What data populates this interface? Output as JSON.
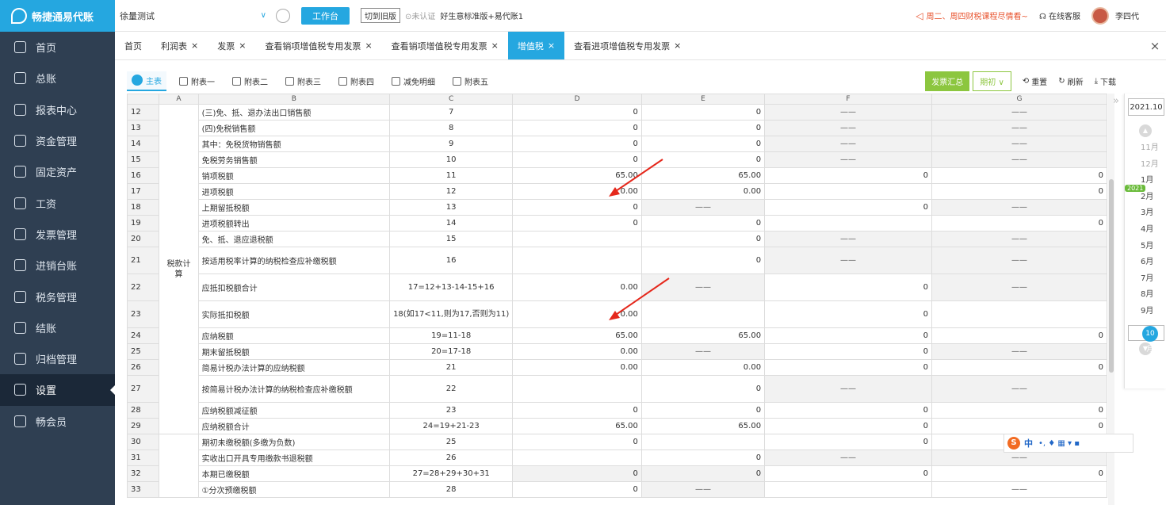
{
  "app": {
    "name": "畅捷通易代账"
  },
  "sidebar": {
    "items": [
      {
        "label": "首页",
        "icon": "home-icon"
      },
      {
        "label": "总账",
        "icon": "ledger-icon"
      },
      {
        "label": "报表中心",
        "icon": "chart-icon"
      },
      {
        "label": "资金管理",
        "icon": "money-icon"
      },
      {
        "label": "固定资产",
        "icon": "asset-icon"
      },
      {
        "label": "工资",
        "icon": "salary-icon"
      },
      {
        "label": "发票管理",
        "icon": "invoice-icon"
      },
      {
        "label": "进销台账",
        "icon": "inventory-icon"
      },
      {
        "label": "税务管理",
        "icon": "tax-icon"
      },
      {
        "label": "结账",
        "icon": "close-book-icon"
      },
      {
        "label": "归档管理",
        "icon": "archive-icon"
      },
      {
        "label": "设置",
        "icon": "gear-icon",
        "active": true
      },
      {
        "label": "畅会员",
        "icon": "member-icon"
      }
    ]
  },
  "topbar": {
    "company": "徐量测试",
    "workbench": "工作台",
    "switch_old": "切到旧版",
    "cert": "未认证",
    "account_info": "好生意标准版+易代账1",
    "notice": "周二、周四财税课程尽情看~",
    "service": "在线客服",
    "user": "李四代"
  },
  "tabs": [
    {
      "label": "首页",
      "closable": false
    },
    {
      "label": "利润表",
      "closable": true
    },
    {
      "label": "发票",
      "closable": true
    },
    {
      "label": "查看销项增值税专用发票",
      "closable": true
    },
    {
      "label": "查看销项增值税专用发票",
      "closable": true
    },
    {
      "label": "增值税",
      "closable": true,
      "active": true
    },
    {
      "label": "查看进项增值税专用发票",
      "closable": true
    }
  ],
  "close_symbol": "×",
  "subtabs": [
    "主表",
    "附表一",
    "附表二",
    "附表三",
    "附表四",
    "减免明细",
    "附表五"
  ],
  "actions": {
    "summary": "发票汇总",
    "period": "期初",
    "reset": "重置",
    "refresh": "刷新",
    "download": "下载"
  },
  "sheet": {
    "cols": [
      "A",
      "B",
      "C",
      "D",
      "E",
      "F",
      "G"
    ],
    "section_label": "税款计算",
    "rows": [
      {
        "n": "12",
        "b": "(三)免、抵、退办法出口销售额",
        "c": "7",
        "d": "0",
        "e": "0",
        "f": "——",
        "g": "——",
        "gf": true
      },
      {
        "n": "13",
        "b": "(四)免税销售额",
        "c": "8",
        "d": "0",
        "e": "0",
        "f": "——",
        "g": "——",
        "gf": true
      },
      {
        "n": "14",
        "b": "其中：免税货物销售额",
        "c": "9",
        "d": "0",
        "e": "0",
        "f": "——",
        "g": "——",
        "gf": true
      },
      {
        "n": "15",
        "b": "免税劳务销售额",
        "c": "10",
        "d": "0",
        "e": "0",
        "f": "——",
        "g": "——",
        "gf": true
      },
      {
        "n": "16",
        "b": "销项税额",
        "c": "11",
        "d": "65.00",
        "e": "65.00",
        "f": "0",
        "g": "0"
      },
      {
        "n": "17",
        "b": "进项税额",
        "c": "12",
        "d": "0.00",
        "e": "0.00",
        "f": "",
        "g": "0"
      },
      {
        "n": "18",
        "b": "上期留抵税额",
        "c": "13",
        "d": "0",
        "e": "——",
        "f": "0",
        "g": "——",
        "ge": true
      },
      {
        "n": "19",
        "b": "进项税额转出",
        "c": "14",
        "d": "0",
        "e": "0",
        "f": "",
        "g": "0"
      },
      {
        "n": "20",
        "b": "免、抵、退应退税额",
        "c": "15",
        "d": "",
        "e": "0",
        "f": "——",
        "g": "——",
        "gf": true
      },
      {
        "n": "21",
        "b": "按适用税率计算的纳税检查应补缴税额",
        "c": "16",
        "d": "",
        "e": "0",
        "f": "——",
        "g": "——",
        "tall": true,
        "gf": true
      },
      {
        "n": "22",
        "b": "应抵扣税额合计",
        "c": "17=12+13-14-15+16",
        "d": "0.00",
        "e": "——",
        "f": "0",
        "g": "——",
        "tall": true,
        "ge": true
      },
      {
        "n": "23",
        "b": "实际抵扣税额",
        "c": "18(如17<11,则为17,否则为11)",
        "d": "0.00",
        "e": "",
        "f": "0",
        "g": "",
        "tall": true
      },
      {
        "n": "24",
        "b": "应纳税额",
        "c": "19=11-18",
        "d": "65.00",
        "e": "65.00",
        "f": "0",
        "g": "0"
      },
      {
        "n": "25",
        "b": "期末留抵税额",
        "c": "20=17-18",
        "d": "0.00",
        "e": "——",
        "f": "0",
        "g": "——",
        "ge": true
      },
      {
        "n": "26",
        "b": "简易计税办法计算的应纳税额",
        "c": "21",
        "d": "0.00",
        "e": "0.00",
        "f": "0",
        "g": "0"
      },
      {
        "n": "27",
        "b": "按简易计税办法计算的纳税检查应补缴税额",
        "c": "22",
        "d": "",
        "e": "0",
        "f": "——",
        "g": "——",
        "tall": true,
        "gf": true
      },
      {
        "n": "28",
        "b": "应纳税额减征额",
        "c": "23",
        "d": "0",
        "e": "0",
        "f": "0",
        "g": "0"
      },
      {
        "n": "29",
        "b": "应纳税额合计",
        "c": "24=19+21-23",
        "d": "65.00",
        "e": "65.00",
        "f": "0",
        "g": "0"
      },
      {
        "n": "30",
        "b": "期初未缴税额(多缴为负数)",
        "c": "25",
        "d": "0",
        "e": "",
        "f": "0",
        "g": ""
      },
      {
        "n": "31",
        "b": "实收出口开具专用缴款书退税额",
        "c": "26",
        "d": "",
        "e": "0",
        "f": "——",
        "g": "——",
        "gf": true
      },
      {
        "n": "32",
        "b": "本期已缴税额",
        "c": "27=28+29+30+31",
        "d": "0",
        "e": "0",
        "f": "0",
        "g": "0",
        "gray": true
      },
      {
        "n": "33",
        "b": "①分次预缴税额",
        "c": "28",
        "d": "0",
        "e": "——",
        "f": "",
        "g": "——"
      }
    ]
  },
  "period": {
    "current": "2021.10",
    "year_badge": "2021",
    "months": [
      "11月",
      "12月",
      "1月",
      "2月",
      "3月",
      "4月",
      "5月",
      "6月",
      "7月",
      "8月",
      "9月",
      "10月"
    ],
    "current_month": "10月"
  },
  "ime": {
    "logo": "S",
    "lang": "中",
    "extras": "•, ♦ ▦ ▾ ▪"
  },
  "colors": {
    "sidebar_bg": "#2f3f52",
    "accent": "#25a7e0",
    "green": "#8cc63f",
    "annotation": "#e5281c"
  }
}
